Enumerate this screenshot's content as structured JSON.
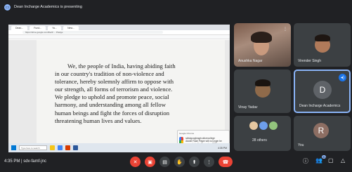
{
  "banner": {
    "text": "Dean Incharge Academics is presenting"
  },
  "browser": {
    "tabs": [
      "Dean...",
      "Fund...",
      "Yo...",
      "New..."
    ],
    "url": "https://drive.google.com/file/d/ ... Pledge"
  },
  "document": {
    "lines": [
      "We, the people of India, having abiding faith",
      "in our country's tradition of non-violence and",
      "tolerance, hereby solemnly affirm to oppose with",
      "our strength, all forms of terrorism and violence.",
      "We pledge to uphold and promote peace, social",
      "harmony, and understanding among all fellow",
      "human beings and fight the forces of disruption",
      "threatening human lives and values."
    ]
  },
  "notification": {
    "header": "Google Chrome",
    "title": "sdiskgoogleagriculturecollege",
    "body": "Adobe Flash Player will no longer be supported after December 2020."
  },
  "taskbar": {
    "search": "Type here to search",
    "clock": "4:35 PM"
  },
  "participants": [
    {
      "name": "Anushka Nagar",
      "type": "camera"
    },
    {
      "name": "Virender Singh",
      "type": "camera"
    },
    {
      "name": "Vinay Yadav",
      "type": "camera"
    },
    {
      "name": "Dean Incharge Academics",
      "type": "avatar",
      "initial": "D",
      "color": "#5f6368"
    },
    {
      "name": "28 others",
      "type": "others"
    },
    {
      "name": "You",
      "type": "avatar",
      "initial": "R",
      "color": "#8d6e63"
    }
  ],
  "meeting": {
    "time": "4:35 PM",
    "code": "sdv-famf-jnc"
  },
  "icons": {
    "mic": "mic-off-icon",
    "cam": "camera-off-icon",
    "captions": "captions-icon",
    "raise": "hand-icon",
    "present": "present-icon",
    "more": "more-icon",
    "end": "end-call-icon",
    "info": "info-icon",
    "people": "people-icon",
    "chat": "chat-icon",
    "activities": "activities-icon"
  },
  "people_count": "31"
}
